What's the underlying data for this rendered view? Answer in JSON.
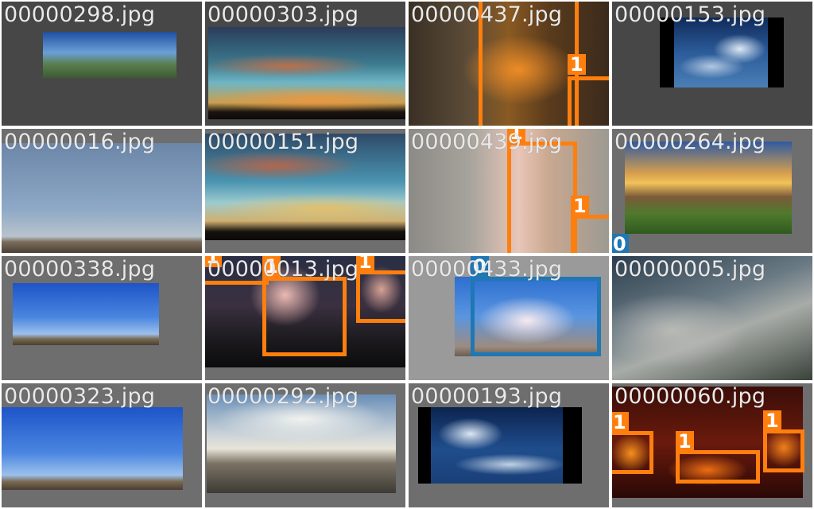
{
  "tiles": [
    {
      "filename": "00000298.jpg",
      "labels": []
    },
    {
      "filename": "00000303.jpg",
      "labels": []
    },
    {
      "filename": "00000437.jpg",
      "labels": [
        "1"
      ]
    },
    {
      "filename": "00000153.jpg",
      "labels": []
    },
    {
      "filename": "00000016.jpg",
      "labels": []
    },
    {
      "filename": "00000151.jpg",
      "labels": []
    },
    {
      "filename": "00000439.jpg",
      "labels": [
        "1",
        "1",
        "0"
      ]
    },
    {
      "filename": "00000264.jpg",
      "labels": []
    },
    {
      "filename": "00000338.jpg",
      "labels": []
    },
    {
      "filename": "00000013.jpg",
      "labels": [
        "1",
        "1",
        "1"
      ]
    },
    {
      "filename": "00000433.jpg",
      "labels": [
        "0"
      ]
    },
    {
      "filename": "00000005.jpg",
      "labels": []
    },
    {
      "filename": "00000323.jpg",
      "labels": []
    },
    {
      "filename": "00000292.jpg",
      "labels": []
    },
    {
      "filename": "00000193.jpg",
      "labels": []
    },
    {
      "filename": "00000060.jpg",
      "labels": [
        "1",
        "1",
        "1"
      ]
    }
  ],
  "colors": {
    "class_1_box": "#ff7f0e",
    "class_0_box": "#1f77b4",
    "filename_text": "#e9e9e9",
    "tile_gray_dark": "#474747",
    "tile_gray_mid": "#6e6e6e",
    "tile_gray_light": "#9a9a9a"
  }
}
